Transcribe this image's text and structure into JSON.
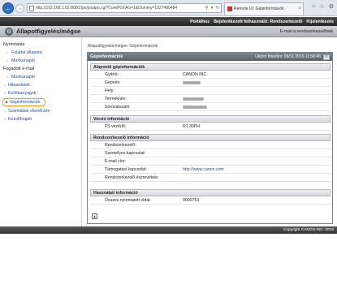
{
  "browser": {
    "url": "http://192.168.1.65:8000/rps/jstatpri.cgi?CorePGTAG=1&Dummy=1527480484",
    "tab_title": "Remote UI: Gépinformációk",
    "back_icon": "back-arrow-icon",
    "window_icons": [
      "home-icon",
      "star-icon",
      "gear-icon"
    ]
  },
  "topbar": {
    "links": [
      "Portálhoz",
      "Bejelentkezett felhasználó: Rendszerkezelő",
      "Kijelentkezés"
    ]
  },
  "header": {
    "title": "Állapotfigyelés/mégse",
    "mail_link": "E-mail a rendszerkezelőnek"
  },
  "sidebar": {
    "sections": [
      {
        "label": "Nyomtatás",
        "items": [
          "Feladat állapota",
          "Munkanapló"
        ]
      },
      {
        "label": "Fogadott e-mail",
        "items": [
          "Munkanapló"
        ]
      }
    ],
    "top_items": [
      "Hibaadatok",
      "Kellékanyagok",
      "Gépinformációk",
      "Számlálási ellenőrzés",
      "Kezelőnapló"
    ],
    "active": "Gépinformációk"
  },
  "main": {
    "breadcrumb": "Állapotfigyelés/mégse: Gépinformációk",
    "panel_title": "Gépinformációk",
    "last_updated": "Utolsó frissítés: 09/11 2016 11:58:46",
    "sections": {
      "basic": {
        "title": "Alapvető gépinformációk",
        "rows": [
          {
            "label": "Gyártó:",
            "value": "CANON INC."
          },
          {
            "label": "Gépnév:",
            "value": ""
          },
          {
            "label": "Hely:",
            "value": ""
          },
          {
            "label": "Terméknév:",
            "value": ""
          },
          {
            "label": "Sorozatszám:",
            "value": ""
          }
        ]
      },
      "version": {
        "title": "Verzió információ",
        "rows": [
          {
            "label": "FS vezérlő:",
            "value": "R1.30PH"
          }
        ]
      },
      "admin": {
        "title": "Rendszerkezelő információ",
        "rows": [
          {
            "label": "Rendszerkezelő:",
            "value": ""
          },
          {
            "label": "Személyes kapcsolat:",
            "value": ""
          },
          {
            "label": "E-mail cím:",
            "value": ""
          },
          {
            "label": "Támogatási kapcsolat:",
            "value": "http://www.canon.com"
          },
          {
            "label": "Rendszerkezelő észrevétele:",
            "value": ""
          }
        ]
      },
      "usage": {
        "title": "Használati információ",
        "rows": [
          {
            "label": "Összes nyomtatott oldal:",
            "value": "0000753"
          }
        ]
      }
    }
  },
  "footer": {
    "copyright": "Copyright CANON INC. 2016"
  }
}
